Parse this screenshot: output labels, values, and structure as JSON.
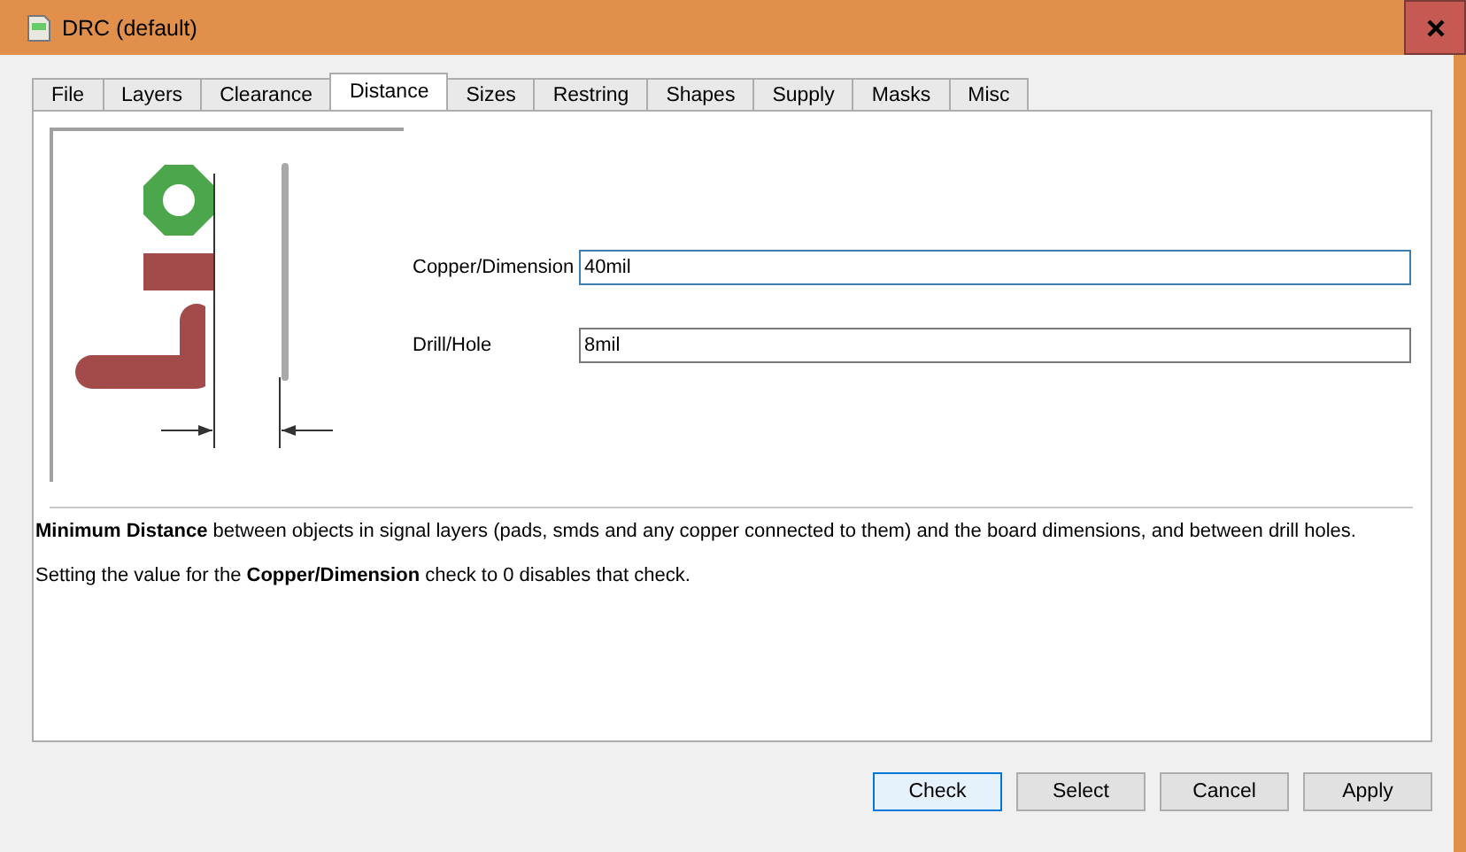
{
  "window": {
    "title": "DRC (default)"
  },
  "tabs": [
    {
      "label": "File",
      "selected": false
    },
    {
      "label": "Layers",
      "selected": false
    },
    {
      "label": "Clearance",
      "selected": false
    },
    {
      "label": "Distance",
      "selected": true
    },
    {
      "label": "Sizes",
      "selected": false
    },
    {
      "label": "Restring",
      "selected": false
    },
    {
      "label": "Shapes",
      "selected": false
    },
    {
      "label": "Supply",
      "selected": false
    },
    {
      "label": "Masks",
      "selected": false
    },
    {
      "label": "Misc",
      "selected": false
    }
  ],
  "fields": [
    {
      "label": "Copper/Dimension",
      "value": "40mil",
      "focused": true
    },
    {
      "label": "Drill/Hole",
      "value": "8mil",
      "focused": false
    }
  ],
  "description": [
    "**Minimum Distance** between objects in signal layers (pads, smds and any copper connected to them) and the board dimensions, and between drill holes.",
    "Setting the value for the **Copper/Dimension** check to 0 disables that check."
  ],
  "buttons": [
    {
      "label": "Check",
      "default": true
    },
    {
      "label": "Select",
      "default": false
    },
    {
      "label": "Cancel",
      "default": false
    },
    {
      "label": "Apply",
      "default": false
    }
  ]
}
